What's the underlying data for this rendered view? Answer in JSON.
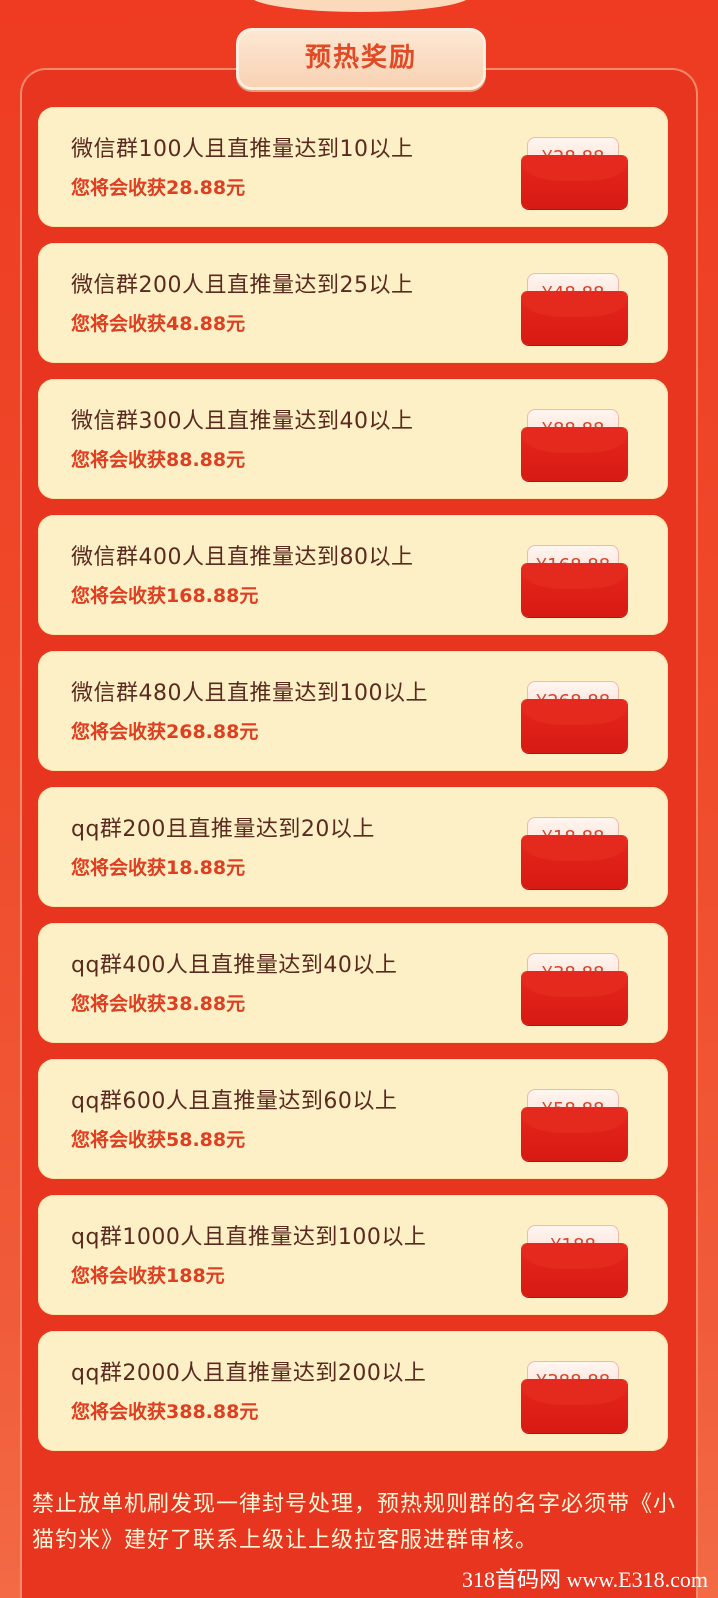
{
  "header": {
    "title": "预热奖励"
  },
  "rewards": [
    {
      "title": "微信群100人且直推量达到10以上",
      "reward_text": "您将会收获28.88元",
      "envelope_amount": "¥28.88"
    },
    {
      "title": "微信群200人且直推量达到25以上",
      "reward_text": "您将会收获48.88元",
      "envelope_amount": "¥48.88"
    },
    {
      "title": "微信群300人且直推量达到40以上",
      "reward_text": "您将会收获88.88元",
      "envelope_amount": "¥88.88"
    },
    {
      "title": "微信群400人且直推量达到80以上",
      "reward_text": "您将会收获168.88元",
      "envelope_amount": "¥168.88"
    },
    {
      "title": "微信群480人且直推量达到100以上",
      "reward_text": "您将会收获268.88元",
      "envelope_amount": "¥268.88"
    },
    {
      "title": "qq群200且直推量达到20以上",
      "reward_text": "您将会收获18.88元",
      "envelope_amount": "¥18.88"
    },
    {
      "title": "qq群400人且直推量达到40以上",
      "reward_text": "您将会收获38.88元",
      "envelope_amount": "¥38.88"
    },
    {
      "title": "qq群600人且直推量达到60以上",
      "reward_text": "您将会收获58.88元",
      "envelope_amount": "¥58.88"
    },
    {
      "title": "qq群1000人且直推量达到100以上",
      "reward_text": "您将会收获188元",
      "envelope_amount": "¥188"
    },
    {
      "title": "qq群2000人且直推量达到200以上",
      "reward_text": "您将会收获388.88元",
      "envelope_amount": "¥388.88"
    }
  ],
  "notice": "禁止放单机刷发现一律封号处理，预热规则群的名字必须带《小猫钓米》建好了联系上级让上级拉客服进群审核。",
  "watermark": "318首码网 www.E318.com",
  "colors": {
    "background": "#ee3b22",
    "card": "#fdf0c6",
    "title_text": "#5a2a1e",
    "reward_text": "#df3e20",
    "envelope": "#e8261c",
    "notice_text": "#fff6d8"
  }
}
